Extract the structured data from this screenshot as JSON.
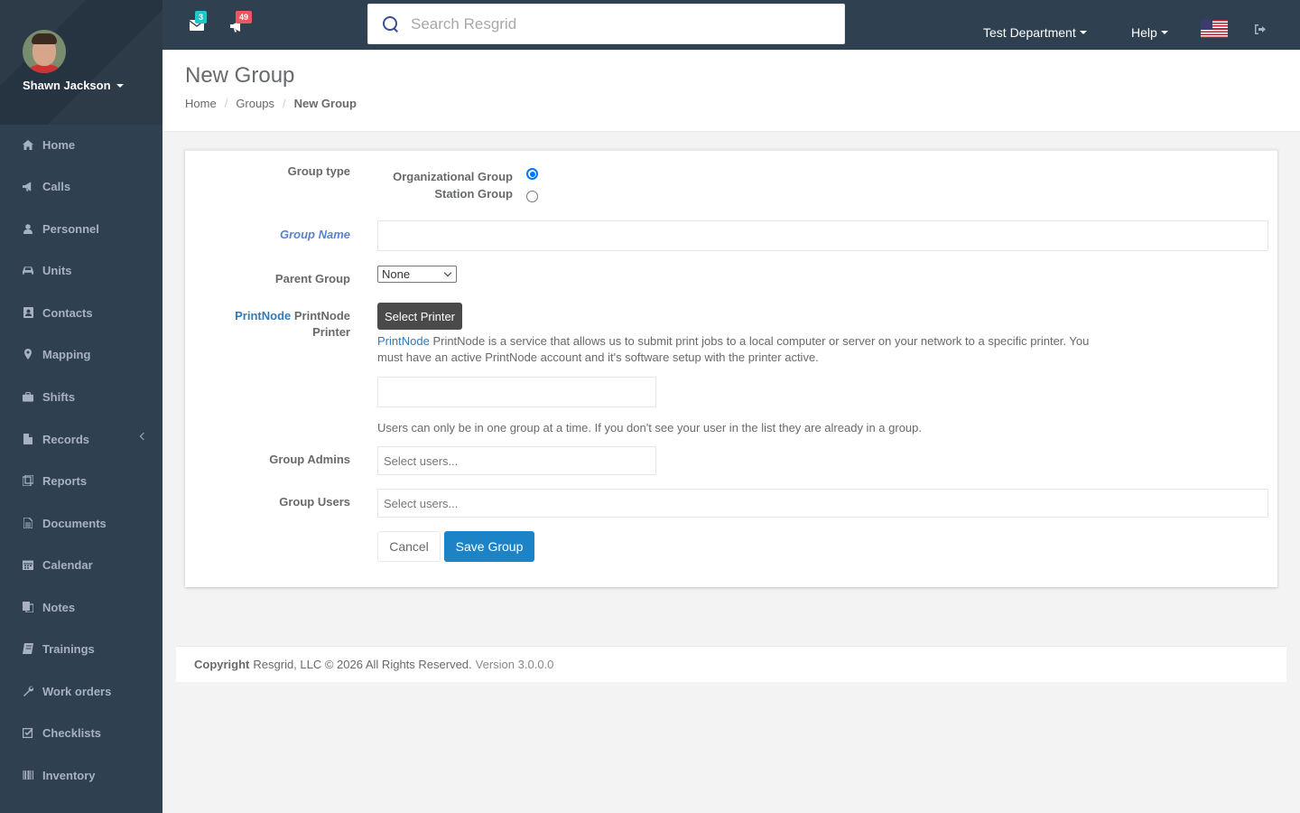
{
  "user": {
    "name": "Shawn Jackson"
  },
  "nav": {
    "items": [
      {
        "label": "Home",
        "icon": "home-icon"
      },
      {
        "label": "Calls",
        "icon": "bullhorn-icon"
      },
      {
        "label": "Personnel",
        "icon": "user-icon"
      },
      {
        "label": "Units",
        "icon": "truck-icon"
      },
      {
        "label": "Contacts",
        "icon": "address-book-icon"
      },
      {
        "label": "Mapping",
        "icon": "map-marker-icon"
      },
      {
        "label": "Shifts",
        "icon": "briefcase-icon"
      },
      {
        "label": "Records",
        "icon": "file-icon"
      },
      {
        "label": "Reports",
        "icon": "reports-icon"
      },
      {
        "label": "Documents",
        "icon": "document-icon"
      },
      {
        "label": "Calendar",
        "icon": "calendar-icon"
      },
      {
        "label": "Notes",
        "icon": "notes-icon"
      },
      {
        "label": "Trainings",
        "icon": "book-icon"
      },
      {
        "label": "Work orders",
        "icon": "wrench-icon"
      },
      {
        "label": "Checklists",
        "icon": "checklist-icon"
      },
      {
        "label": "Inventory",
        "icon": "barcode-icon"
      }
    ]
  },
  "topbar": {
    "messages_count": "3",
    "alerts_count": "49",
    "search_placeholder": "Search Resgrid",
    "department": "Test Department",
    "help": "Help"
  },
  "heading": {
    "title": "New Group",
    "breadcrumb": [
      "Home",
      "Groups",
      "New Group"
    ]
  },
  "form": {
    "group_type_label": "Group type",
    "group_type_options": [
      "Organizational Group",
      "Station Group"
    ],
    "group_type_selected": "Organizational Group",
    "group_name_label": "Group Name",
    "group_name_value": "",
    "parent_group_label": "Parent Group",
    "parent_group_value": "None",
    "printnode_link": "PrintNode",
    "printnode_label_rest": "PrintNode",
    "printnode_label_line2": "Printer",
    "select_printer_button": "Select Printer",
    "printnode_help_link": "PrintNode",
    "printnode_help_line1": "PrintNode is a service that allows us to submit print jobs to a local computer or server on your network to a specific printer. You",
    "printnode_help_line2": "must have an active PrintNode account and it's software setup with the printer active.",
    "printer_value": "",
    "users_note": "Users can only be in one group at a time. If you don't see your user in the list they are already in a group.",
    "group_admins_label": "Group Admins",
    "group_admins_placeholder": "Select users...",
    "group_users_label": "Group Users",
    "group_users_placeholder": "Select users...",
    "cancel_button": "Cancel",
    "save_button": "Save Group"
  },
  "footer": {
    "copyright_bold": "Copyright",
    "copyright_text": "Resgrid, LLC © 2026 All Rights Reserved.",
    "version": "Version 3.0.0.0"
  },
  "colors": {
    "sidebar": "#2f4050",
    "primary_button": "#1c84c6",
    "link": "#337ab7",
    "badge_info": "#23c6c8",
    "badge_danger": "#ed5565"
  }
}
